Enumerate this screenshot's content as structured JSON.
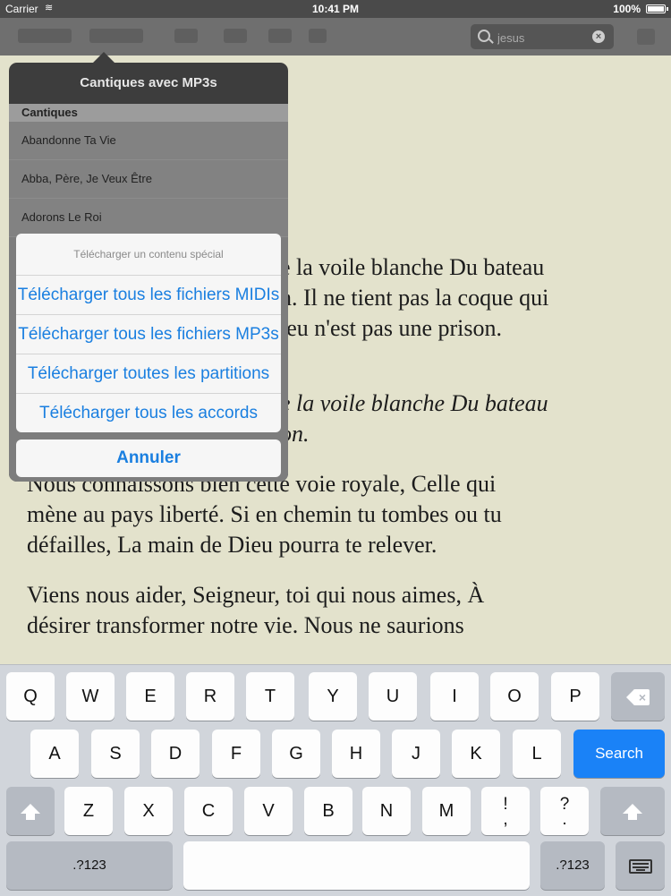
{
  "status_bar": {
    "carrier": "Carrier",
    "time": "10:41 PM",
    "battery": "100%"
  },
  "toolbar": {
    "search": {
      "value": "jesus",
      "placeholder": "jesus"
    }
  },
  "reading": {
    "paragraphs": [
      {
        "lines": [
          "e la voile blanche Du bateau",
          "n. Il ne tient pas la coque qui",
          "ieu n'est pas une prison."
        ],
        "italic": false
      },
      {
        "lines": [
          "e la voile blanche Du bateau",
          "on."
        ],
        "italic": true
      },
      {
        "lines": [
          "Nous connaissons bien cette voie royale, Celle qui",
          "mène au pays liberté. Si en chemin tu tombes ou tu",
          "défailles, La main de Dieu pourra te relever."
        ],
        "italic": false
      },
      {
        "lines": [
          "Viens nous aider, Seigneur, toi qui nous aimes, À",
          "désirer transformer notre vie. Nous ne saurions"
        ],
        "italic": false
      }
    ]
  },
  "popover": {
    "title": "Cantiques avec MP3s",
    "section_header": "Cantiques",
    "rows": [
      "Abandonne Ta Vie",
      "Abba, Père, Je Veux Être",
      "Adorons Le Roi"
    ]
  },
  "action_sheet": {
    "title": "Télécharger un contenu spécial",
    "actions": [
      "Télécharger tous les fichiers MIDIs",
      "Télécharger tous les fichiers MP3s",
      "Télécharger toutes les partitions",
      "Télécharger tous les accords"
    ],
    "cancel": "Annuler"
  },
  "keyboard": {
    "row1": [
      "Q",
      "W",
      "E",
      "R",
      "T",
      "Y",
      "U",
      "I",
      "O",
      "P"
    ],
    "row2": [
      "A",
      "S",
      "D",
      "F",
      "G",
      "H",
      "J",
      "K",
      "L"
    ],
    "row3": [
      "Z",
      "X",
      "C",
      "V",
      "B",
      "N",
      "M"
    ],
    "punct1_top": "!",
    "punct1_bottom": ",",
    "punct2_top": "?",
    "punct2_bottom": ".",
    "search_label": "Search",
    "numbers_label": ".?123",
    "icons": {
      "backspace": "backspace-icon",
      "shift": "shift-icon",
      "dismiss": "keyboard-dismiss-icon"
    }
  },
  "colors": {
    "page_background": "#e3e2cc",
    "link_blue": "#1a7fe0",
    "search_key": "#1a82f7"
  }
}
